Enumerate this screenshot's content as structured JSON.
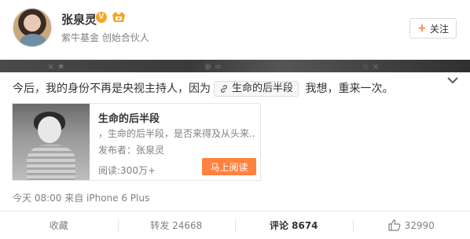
{
  "user": {
    "name": "张泉灵",
    "verified_mark": "V",
    "subtitle": "紫牛基金 创始合伙人",
    "follow_label": "关注"
  },
  "banner": {
    "decorations": [
      "× ★",
      "⊕ ∞",
      "☆ ×"
    ]
  },
  "post": {
    "text_before": "今后，我的身份不再是央视主持人，因为",
    "link_label": "生命的后半段",
    "text_after": " 我想，重来一次。"
  },
  "article": {
    "title": "生命的后半段",
    "description": "，生命的后半段，是否来得及从头来...",
    "publisher": "发布者：张泉灵",
    "reads": "阅读:300万+",
    "read_button": "马上阅读"
  },
  "meta": {
    "source_line": "今天 08:00 来自 iPhone 6 Plus"
  },
  "actions": {
    "collect": "收藏",
    "repost": "转发 24668",
    "comment": "评论 8674",
    "like": "32990"
  },
  "colors": {
    "accent_orange": "#ff8140",
    "verified_gold": "#f5a623",
    "muted_text": "#808080"
  },
  "icons": [
    "verified-icon",
    "vip-member-icon",
    "plus-icon",
    "chevron-down-icon",
    "link-icon",
    "thumbs-up-icon"
  ]
}
